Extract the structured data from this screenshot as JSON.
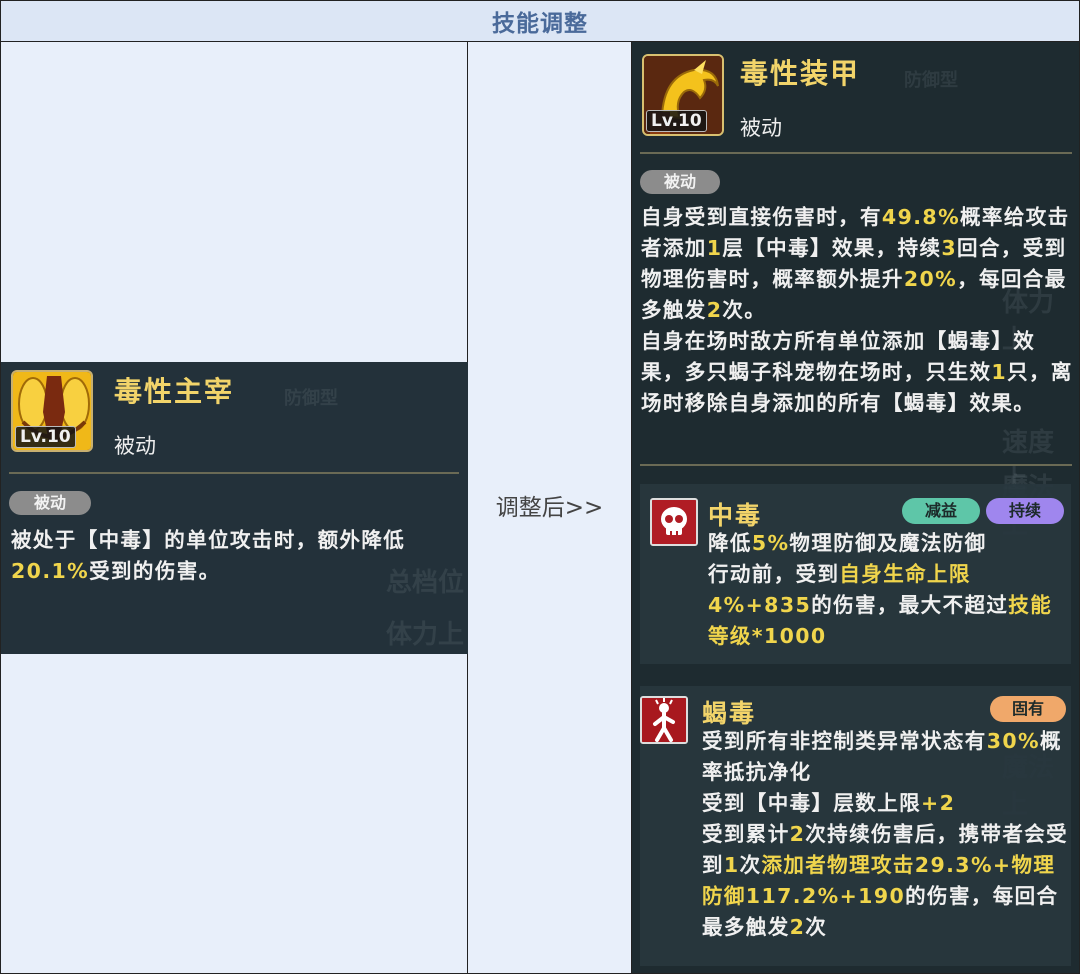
{
  "header": {
    "title": "技能调整"
  },
  "middle": {
    "label": "调整后>>"
  },
  "old_skill": {
    "name": "毒性主宰",
    "level": "Lv.10",
    "type": "被动",
    "tag": "被动",
    "desc_parts": [
      {
        "t": "被处于【中毒】的单位攻击时，额外降低"
      },
      {
        "t": "20.1%",
        "hl": true
      },
      {
        "t": "受到的伤害。"
      }
    ]
  },
  "new_skill": {
    "name": "毒性装甲",
    "level": "Lv.10",
    "type": "被动",
    "tag": "被动",
    "desc_parts": [
      {
        "t": "自身受到直接伤害时，有"
      },
      {
        "t": "49.8%",
        "hl": true
      },
      {
        "t": "概率给攻击者添加"
      },
      {
        "t": "1",
        "hl": true
      },
      {
        "t": "层【中毒】效果，持续"
      },
      {
        "t": "3",
        "hl": true
      },
      {
        "t": "回合，受到物理伤害时，概率额外提升"
      },
      {
        "t": "20%",
        "hl": true
      },
      {
        "t": "，每回合最多触发"
      },
      {
        "t": "2",
        "hl": true
      },
      {
        "t": "次。\n自身在场时敌方所有单位添加【蝎毒】效果，多只蝎子科宠物在场时，只生效"
      },
      {
        "t": "1",
        "hl": true
      },
      {
        "t": "只，离场时移除自身添加的所有【蝎毒】效果。"
      }
    ]
  },
  "effects": [
    {
      "name": "中毒",
      "icon": "skull-icon",
      "tags": [
        {
          "label": "减益",
          "color": "#5ec6a8"
        },
        {
          "label": "持续",
          "color": "#9f86ee"
        }
      ],
      "desc_parts": [
        {
          "t": "降低"
        },
        {
          "t": "5%",
          "hl": true
        },
        {
          "t": "物理防御及魔法防御\n行动前，受到"
        },
        {
          "t": "自身生命上限4%+835",
          "hl": true
        },
        {
          "t": "的伤害，最大不超过"
        },
        {
          "t": "技能等级*1000",
          "hl": true
        }
      ]
    },
    {
      "name": "蝎毒",
      "icon": "poisoned-figure-icon",
      "tags": [
        {
          "label": "固有",
          "color": "#f0a86a"
        }
      ],
      "desc_parts": [
        {
          "t": "受到所有非控制类异常状态有"
        },
        {
          "t": "30%",
          "hl": true
        },
        {
          "t": "概率抵抗净化\n受到【中毒】层数上限"
        },
        {
          "t": "+2",
          "hl": true
        },
        {
          "t": "\n受到累计"
        },
        {
          "t": "2",
          "hl": true
        },
        {
          "t": "次持续伤害后，携带者会受到"
        },
        {
          "t": "1",
          "hl": true
        },
        {
          "t": "次"
        },
        {
          "t": "添加者物理攻击29.3%+物理防御117.2%+190",
          "hl": true
        },
        {
          "t": "的伤害，每回合最多触发"
        },
        {
          "t": "2",
          "hl": true
        },
        {
          "t": "次"
        }
      ]
    }
  ],
  "colors": {
    "highlight": "#f0d54c",
    "name": "#f2d46a",
    "panel": "#23313a"
  }
}
